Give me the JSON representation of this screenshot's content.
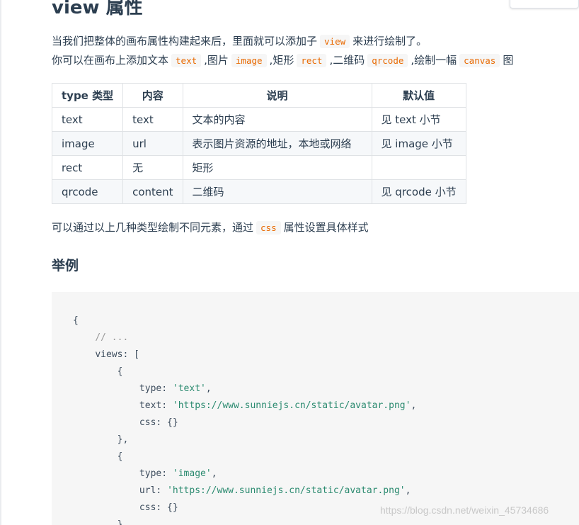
{
  "heading": {
    "prefix": "view ",
    "suffix": "属性"
  },
  "intro": {
    "line1": {
      "before": "当我们把整体的画布属性构建起来后，里面就可以添加子",
      "code": "view",
      "after": "来进行绘制了。"
    },
    "line2": {
      "t1": "你可以在画布上添加文本",
      "c1": "text",
      "t2": ",图片",
      "c2": "image",
      "t3": ",矩形",
      "c3": "rect",
      "t4": ",二维码",
      "c4": "qrcode",
      "t5": ",绘制一幅",
      "c5": "canvas",
      "t6": "图"
    }
  },
  "table": {
    "headers": [
      "type 类型",
      "内容",
      "说明",
      "默认值"
    ],
    "rows": [
      [
        "text",
        "text",
        "文本的内容",
        "见 text 小节"
      ],
      [
        "image",
        "url",
        "表示图片资源的地址，本地或网络",
        "见 image 小节"
      ],
      [
        "rect",
        "无",
        "矩形",
        ""
      ],
      [
        "qrcode",
        "content",
        "二维码",
        "见 qrcode 小节"
      ]
    ]
  },
  "note": {
    "before": "可以通过以上几种类型绘制不同元素，通过",
    "code": "css",
    "after": "属性设置具体样式"
  },
  "example_heading": "举例",
  "code": {
    "l1": "{",
    "l2": "// ...",
    "l3": "views: [",
    "l4": "{",
    "l5_key": "type: ",
    "l5_val": "'text'",
    "l5_end": ",",
    "l6_key": "text: ",
    "l6_val": "'https://www.sunniejs.cn/static/avatar.png'",
    "l6_end": ",",
    "l7": "css: {}",
    "l8": "},",
    "l9": "{",
    "l10_key": "type: ",
    "l10_val": "'image'",
    "l10_end": ",",
    "l11_key": "url: ",
    "l11_val": "'https://www.sunniejs.cn/static/avatar.png'",
    "l11_end": ",",
    "l12": "css: {}",
    "l13": "}"
  },
  "watermark": "https://blog.csdn.net/weixin_45734686",
  "colors": {
    "inline_code": "#e96900",
    "code_string": "#2a8a6f",
    "text": "#2c3e50"
  }
}
